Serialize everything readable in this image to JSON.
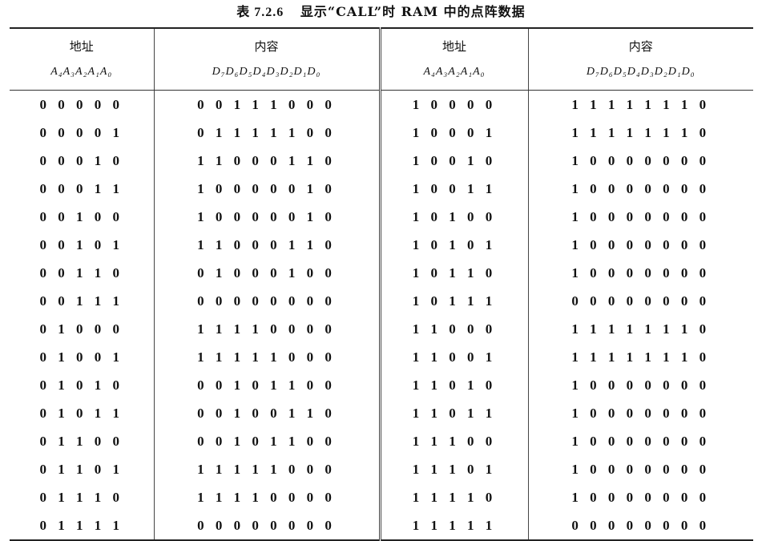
{
  "caption": {
    "number": "表 7.2.6",
    "title": "显示“CALL”时 RAM 中的点阵数据"
  },
  "table": {
    "headers": [
      "地址",
      "内容",
      "地址",
      "内容"
    ],
    "subheaders": [
      "A₄A₃A₂A₁A₀",
      "D₇D₆D₅D₄D₃D₂D₁D₀",
      "A₄A₃A₂A₁A₀",
      "D₇D₆D₅D₄D₃D₂D₁D₀"
    ],
    "rows": [
      [
        "0 0 0 0 0",
        "0 0 1 1 1 0 0 0",
        "1 0 0 0 0",
        "1 1 1 1 1 1 1 0"
      ],
      [
        "0 0 0 0 1",
        "0 1 1 1 1 1 0 0",
        "1 0 0 0 1",
        "1 1 1 1 1 1 1 0"
      ],
      [
        "0 0 0 1 0",
        "1 1 0 0 0 1 1 0",
        "1 0 0 1 0",
        "1 0 0 0 0 0 0 0"
      ],
      [
        "0 0 0 1 1",
        "1 0 0 0 0 0 1 0",
        "1 0 0 1 1",
        "1 0 0 0 0 0 0 0"
      ],
      [
        "0 0 1 0 0",
        "1 0 0 0 0 0 1 0",
        "1 0 1 0 0",
        "1 0 0 0 0 0 0 0"
      ],
      [
        "0 0 1 0 1",
        "1 1 0 0 0 1 1 0",
        "1 0 1 0 1",
        "1 0 0 0 0 0 0 0"
      ],
      [
        "0 0 1 1 0",
        "0 1 0 0 0 1 0 0",
        "1 0 1 1 0",
        "1 0 0 0 0 0 0 0"
      ],
      [
        "0 0 1 1 1",
        "0 0 0 0 0 0 0 0",
        "1 0 1 1 1",
        "0 0 0 0 0 0 0 0"
      ],
      [
        "0 1 0 0 0",
        "1 1 1 1 0 0 0 0",
        "1 1 0 0 0",
        "1 1 1 1 1 1 1 0"
      ],
      [
        "0 1 0 0 1",
        "1 1 1 1 1 0 0 0",
        "1 1 0 0 1",
        "1 1 1 1 1 1 1 0"
      ],
      [
        "0 1 0 1 0",
        "0 0 1 0 1 1 0 0",
        "1 1 0 1 0",
        "1 0 0 0 0 0 0 0"
      ],
      [
        "0 1 0 1 1",
        "0 0 1 0 0 1 1 0",
        "1 1 0 1 1",
        "1 0 0 0 0 0 0 0"
      ],
      [
        "0 1 1 0 0",
        "0 0 1 0 1 1 0 0",
        "1 1 1 0 0",
        "1 0 0 0 0 0 0 0"
      ],
      [
        "0 1 1 0 1",
        "1 1 1 1 1 0 0 0",
        "1 1 1 0 1",
        "1 0 0 0 0 0 0 0"
      ],
      [
        "0 1 1 1 0",
        "1 1 1 1 0 0 0 0",
        "1 1 1 1 0",
        "1 0 0 0 0 0 0 0"
      ],
      [
        "0 1 1 1 1",
        "0 0 0 0 0 0 0 0",
        "1 1 1 1 1",
        "0 0 0 0 0 0 0 0"
      ]
    ]
  }
}
